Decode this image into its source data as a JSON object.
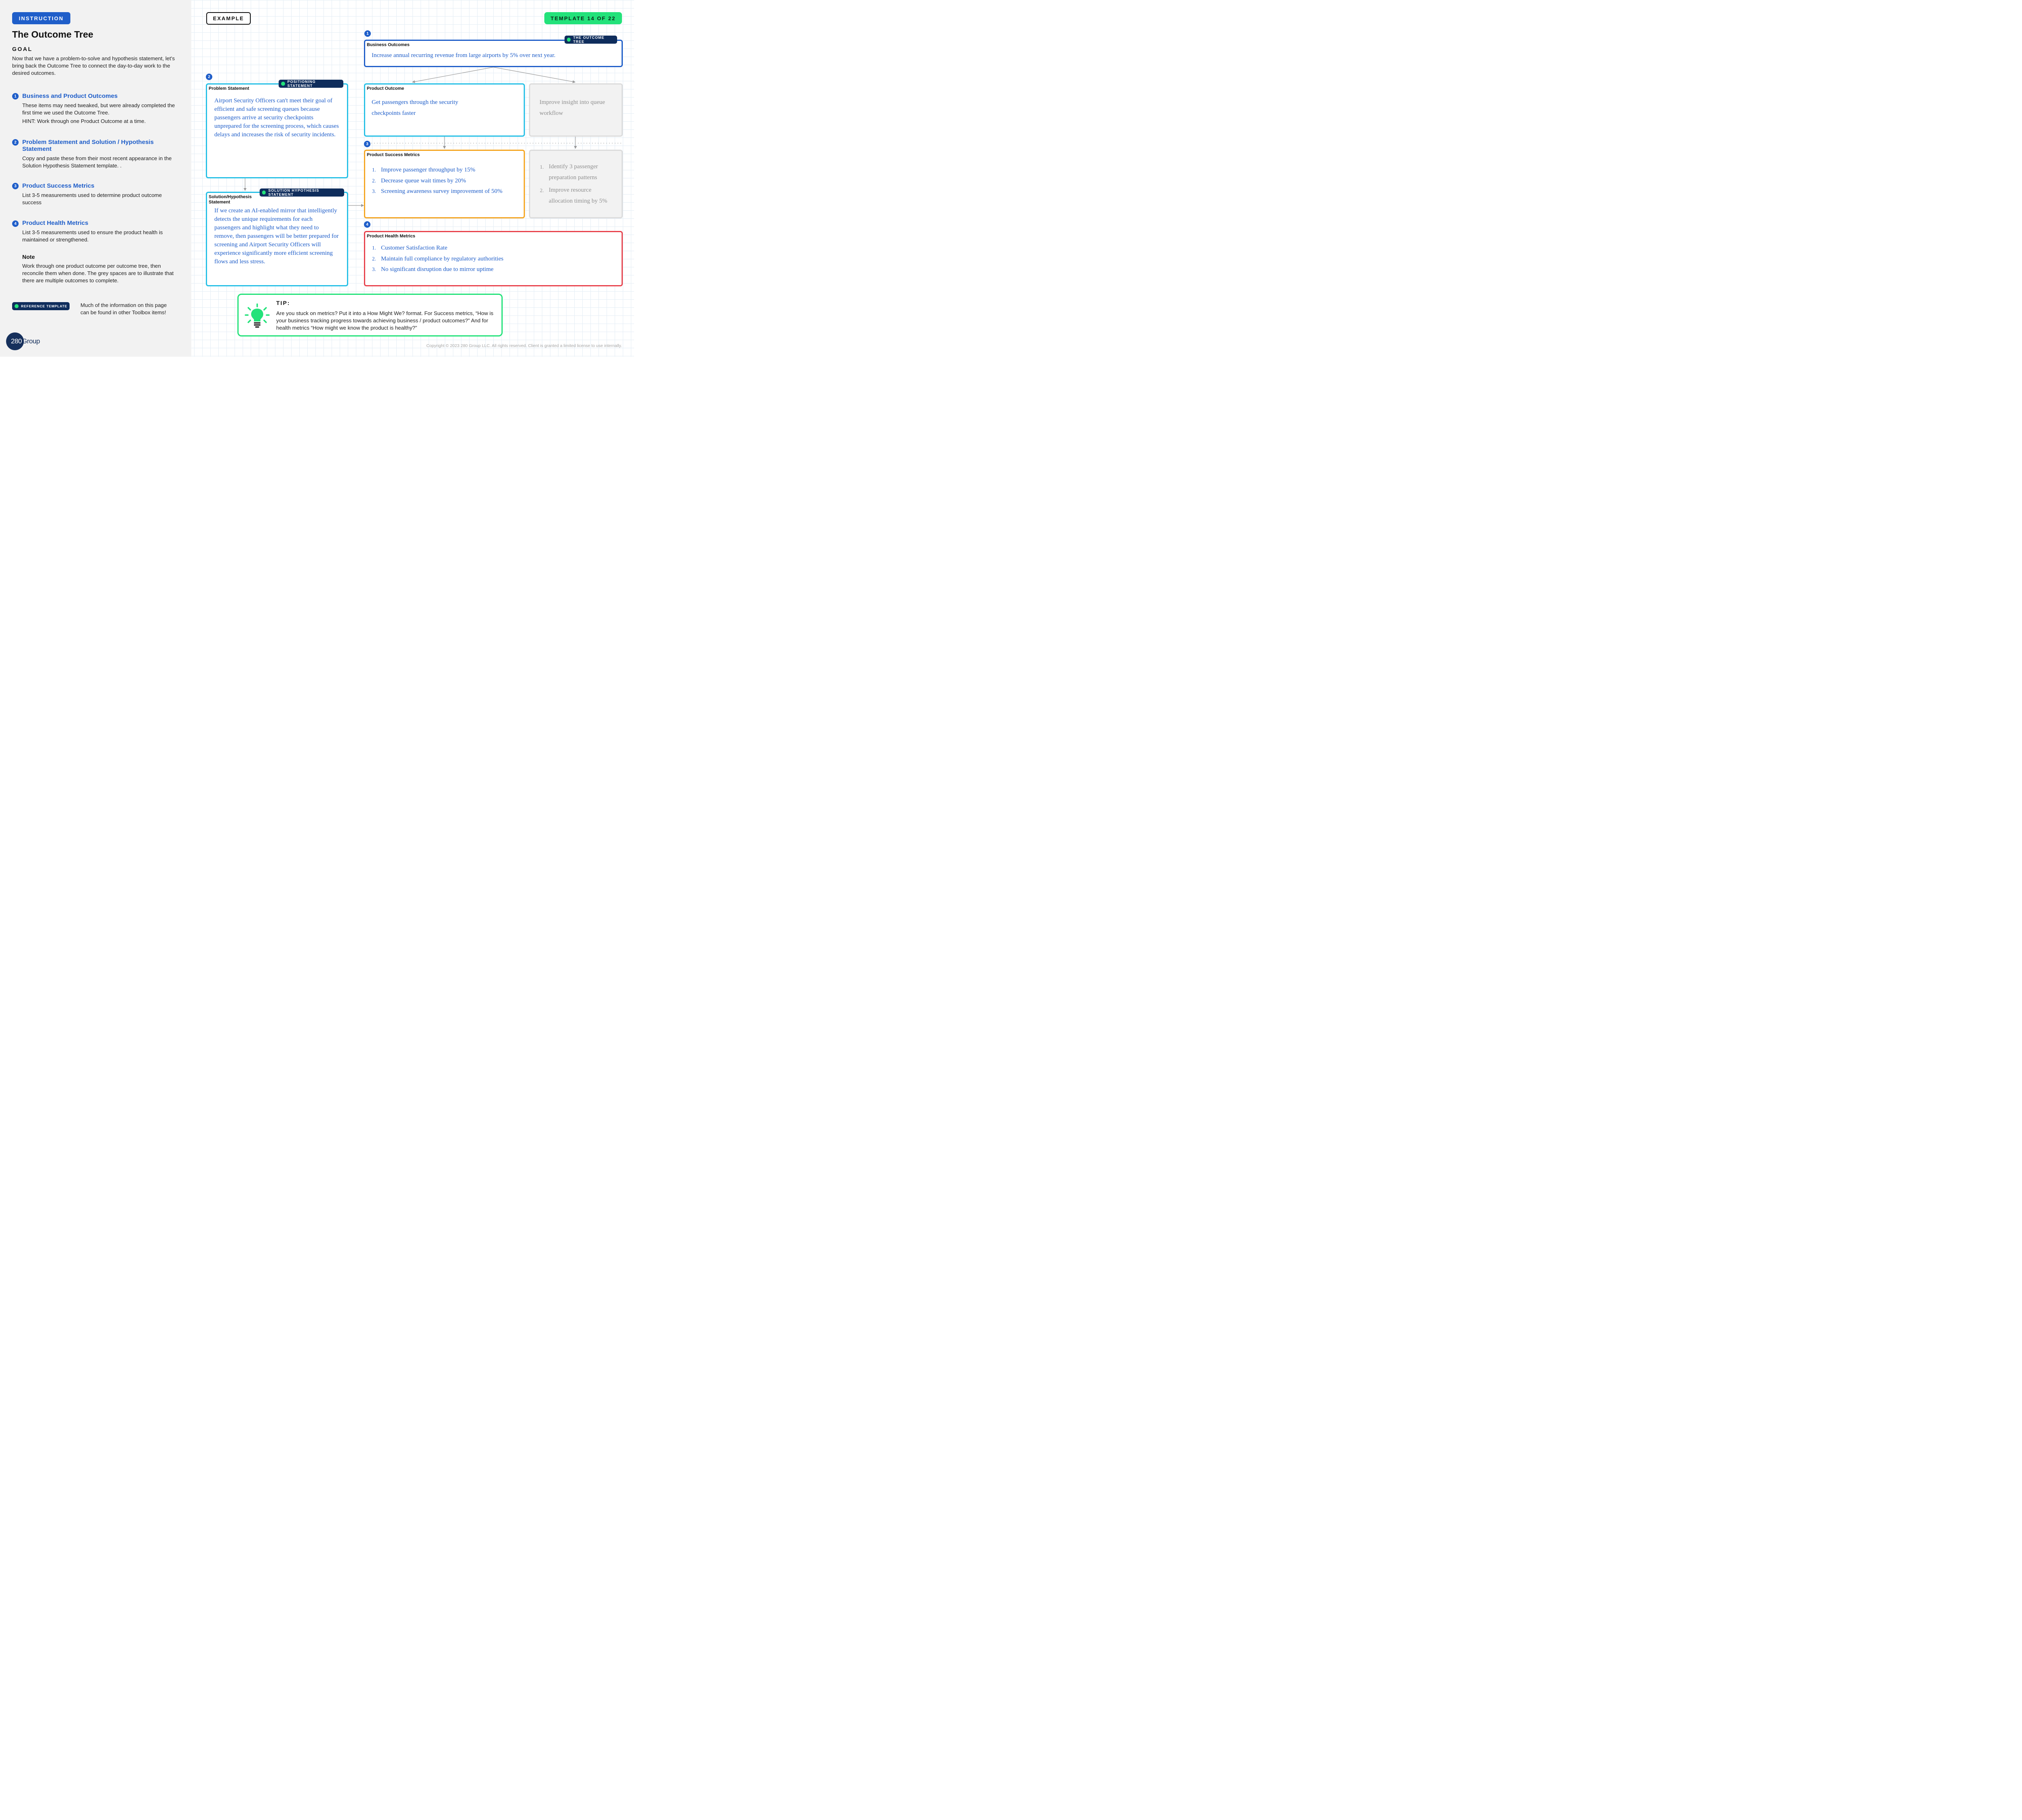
{
  "instruction_label": "INSTRUCTION",
  "example_label": "EXAMPLE",
  "template_label": "TEMPLATE 14 OF 22",
  "title": "The Outcome Tree",
  "goal": {
    "heading": "GOAL",
    "text": "Now that we have a problem-to-solve and hypothesis statement, let’s bring back the Outcome Tree to connect the day-to-day work to the desired outcomes."
  },
  "sections": [
    {
      "num": "1",
      "heading": "Business and Product Outcomes",
      "text": "These items may need tweaked, but were already completed the first time we used the Outcome Tree.",
      "hint": "HINT: Work through one Product Outcome at a time."
    },
    {
      "num": "2",
      "heading": "Problem Statement and Solution / Hypothesis Statement",
      "text": "Copy and paste these from their most recent appearance in the Solution Hypothesis Statement template. ."
    },
    {
      "num": "3",
      "heading": "Product Success Metrics",
      "text": "List 3-5 measurements used to determine product outcome success"
    },
    {
      "num": "4",
      "heading": "Product Health Metrics",
      "text": "List 3-5 measurements used to ensure the product health is maintained or strengthened."
    }
  ],
  "note": {
    "heading": "Note",
    "text": "Work through one product outcome per outcome tree, then reconcile them when done. The grey spaces are to illustrate that there are multiple outcomes to complete."
  },
  "reference": {
    "badge": "REFERENCE TEMPLATE",
    "text": "Much of the information on this page can be found in other Toolbox items!"
  },
  "logo": {
    "num": "280",
    "word": "Group"
  },
  "diagram": {
    "business_outcomes": {
      "num": "1",
      "label": "Business Outcomes",
      "badge": "THE OUTCOME TREE",
      "text": "Increase annual recurring revenue from large airports by 5% over next year."
    },
    "problem_statement": {
      "num": "2",
      "label": "Problem Statement",
      "badge": "POSITIONING STATEMENT",
      "text": "Airport Security Officers can't meet their goal of efficient and safe screening queues because passengers arrive at security checkpoints unprepared for the screening process, which causes delays and increases the risk of security incidents."
    },
    "solution_statement": {
      "label": "Solution/Hypothesis Statement",
      "badge": "SOLUTION HYPOTHESIS STATEMENT",
      "text": "If we create an AI-enabled mirror that intelligently detects the unique requirements for each passengers and highlight what they need to remove, then passengers will be better prepared for screening and Airport Security Officers will experience significantly more efficient screening flows and less stress."
    },
    "product_outcome": {
      "label": "Product Outcome",
      "text": "Get passengers through the security checkpoints faster"
    },
    "product_outcome_grey": {
      "text": "Improve insight into queue workflow"
    },
    "success_metrics": {
      "num": "3",
      "label": "Product Success Metrics",
      "items": [
        {
          "n": "1.",
          "text": "Improve passenger throughput by 15%"
        },
        {
          "n": "2.",
          "text": "Decrease queue wait times by 20%"
        },
        {
          "n": "3.",
          "text": "Screening awareness survey improvement of 50%"
        }
      ]
    },
    "success_metrics_grey": {
      "items": [
        {
          "n": "1.",
          "text": "Identify 3 passenger preparation patterns"
        },
        {
          "n": "2.",
          "text": "Improve resource allocation timing by 5%"
        }
      ]
    },
    "health_metrics": {
      "num": "4",
      "label": "Product Health Metrics",
      "items": [
        {
          "n": "1.",
          "text": "Customer Satisfaction Rate"
        },
        {
          "n": "2.",
          "text": "Maintain full compliance by regulatory authorities"
        },
        {
          "n": "3.",
          "text": "No significant disruption due to mirror uptime"
        }
      ]
    }
  },
  "tip": {
    "heading": "TIP:",
    "text": "Are you stuck on metrics? Put it into a How Might We? format. For Success metrics, “How is your business tracking progress towards achieving business / product outcomes?” And for health metrics “How might we know the product is healthy?”"
  },
  "copyright": "Copyright © 2023 280 Group LLC. All rights reserved. Client is granted a limited license to use internally.",
  "colors": {
    "blue": "#1f5ec9",
    "cyan": "#27c0e6",
    "orange": "#f5a623",
    "red": "#e8424c",
    "green": "#23e27a",
    "navy": "#0f2d5c",
    "grey": "#d9d9d9"
  },
  "icons": [
    "lightbulb-icon"
  ]
}
